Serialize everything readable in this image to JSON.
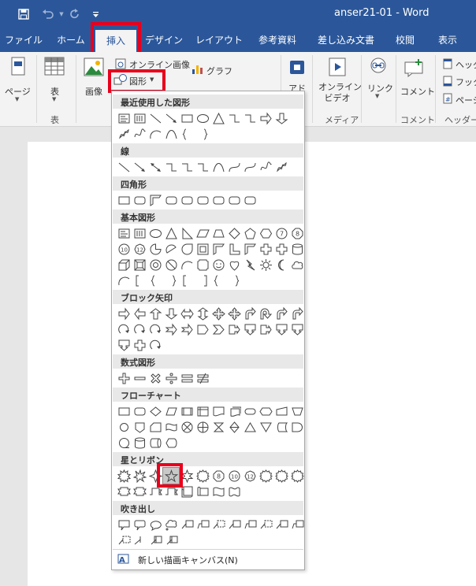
{
  "window": {
    "title": "anser21-01  -  Word"
  },
  "quick_access": {
    "save_icon": "save-icon",
    "undo_icon": "undo-icon",
    "redo_icon": "redo-icon",
    "customize_icon": "customize-icon"
  },
  "tabs": [
    {
      "label": "ファイル"
    },
    {
      "label": "ホーム"
    },
    {
      "label": "挿入",
      "active": true
    },
    {
      "label": "デザイン"
    },
    {
      "label": "レイアウト"
    },
    {
      "label": "参考資料"
    },
    {
      "label": "差し込み文書"
    },
    {
      "label": "校閲"
    },
    {
      "label": "表示"
    }
  ],
  "ribbon": {
    "page_label": "ページ",
    "table_label": "表",
    "table_group": "表",
    "image_label": "画像",
    "online_image_label": "オンライン画像",
    "shapes_label": "図形",
    "graph_label": "グラフ",
    "addin_label": "アド\nイン",
    "online_video_label": "オンライン\nビデオ",
    "media_group": "メディア",
    "link_label": "リンク",
    "comment_label": "コメント",
    "comment_group": "コメント",
    "header_label": "ヘッダー",
    "footer_label": "フッター",
    "page_number_label": "ページ",
    "header_footer_group": "ヘッダーと"
  },
  "shapes_menu": {
    "sections": [
      "最近使用した図形",
      "線",
      "四角形",
      "基本図形",
      "ブロック矢印",
      "数式図形",
      "フローチャート",
      "星とリボン",
      "吹き出し"
    ],
    "new_canvas_label": "新しい描画キャンバス(N)",
    "selected_shape": "5-point-star"
  },
  "colors": {
    "accent": "#2b579a",
    "highlight": "#e8001c"
  }
}
